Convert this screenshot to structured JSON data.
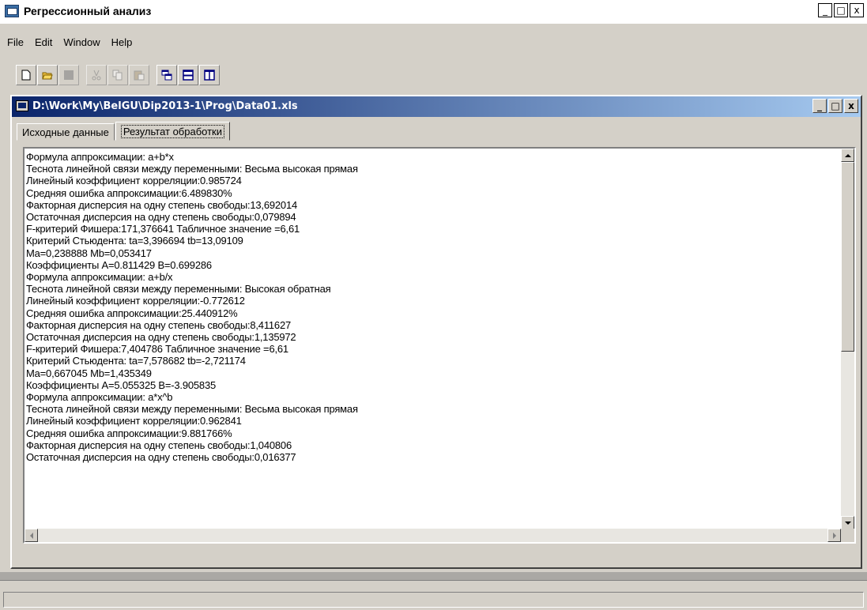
{
  "app": {
    "title": "Регрессионный анализ",
    "window_buttons": [
      "_",
      "□",
      "x"
    ]
  },
  "menu": [
    {
      "label": "File"
    },
    {
      "label": "Edit"
    },
    {
      "label": "Window"
    },
    {
      "label": "Help"
    }
  ],
  "toolbar": {
    "buttons": [
      {
        "icon": "new-document-icon"
      },
      {
        "icon": "open-folder-icon"
      },
      {
        "icon": "save-icon",
        "disabled": true
      },
      {
        "icon": "cut-icon",
        "disabled": true
      },
      {
        "icon": "copy-icon",
        "disabled": true
      },
      {
        "icon": "paste-icon",
        "disabled": true
      },
      {
        "icon": "cascade-windows-icon"
      },
      {
        "icon": "tile-horizontal-icon"
      },
      {
        "icon": "tile-vertical-icon"
      }
    ]
  },
  "document": {
    "title": "D:\\Work\\My\\BelGU\\Dip2013-1\\Prog\\Data01.xls",
    "tabs": [
      {
        "label": "Исходные данные",
        "active": false
      },
      {
        "label": "Результат обработки",
        "active": true
      }
    ],
    "lines": [
      "Формула аппроксимации: a+b*x",
      "Теснота линейной связи между переменными: Весьма высокая прямая",
      "Линейный коэффициент корреляции:0.985724",
      "Средняя ошибка аппроксимации:6.489830%",
      "Факторная дисперсия на одну степень свободы:13,692014",
      "Остаточная дисперсия на одну степень свободы:0,079894",
      "F-критерий Фишера:171,376641 Табличное значение =6,61",
      "Критерий Стьюдента: ta=3,396694 tb=13,09109",
      "Ma=0,238888 Mb=0,053417",
      "Коэффициенты A=0.811429 B=0.699286",
      "Формула аппроксимации: a+b/x",
      "Теснота линейной связи между переменными: Высокая обратная",
      "Линейный коэффициент корреляции:-0.772612",
      "Средняя ошибка аппроксимации:25.440912%",
      "Факторная дисперсия на одну степень свободы:8,411627",
      "Остаточная дисперсия на одну степень свободы:1,135972",
      "F-критерий Фишера:7,404786 Табличное значение =6,61",
      "Критерий Стьюдента: ta=7,578682 tb=-2,721174",
      "Ma=0,667045 Mb=1,435349",
      "Коэффициенты A=5.055325 B=-3.905835",
      "Формула аппроксимации: a*x^b",
      "Теснота линейной связи между переменными: Весьма высокая прямая",
      "Линейный коэффициент корреляции:0.962841",
      "Средняя ошибка аппроксимации:9.881766%",
      "Факторная дисперсия на одну степень свободы:1,040806",
      "Остаточная дисперсия на одну степень свободы:0,016377"
    ]
  }
}
